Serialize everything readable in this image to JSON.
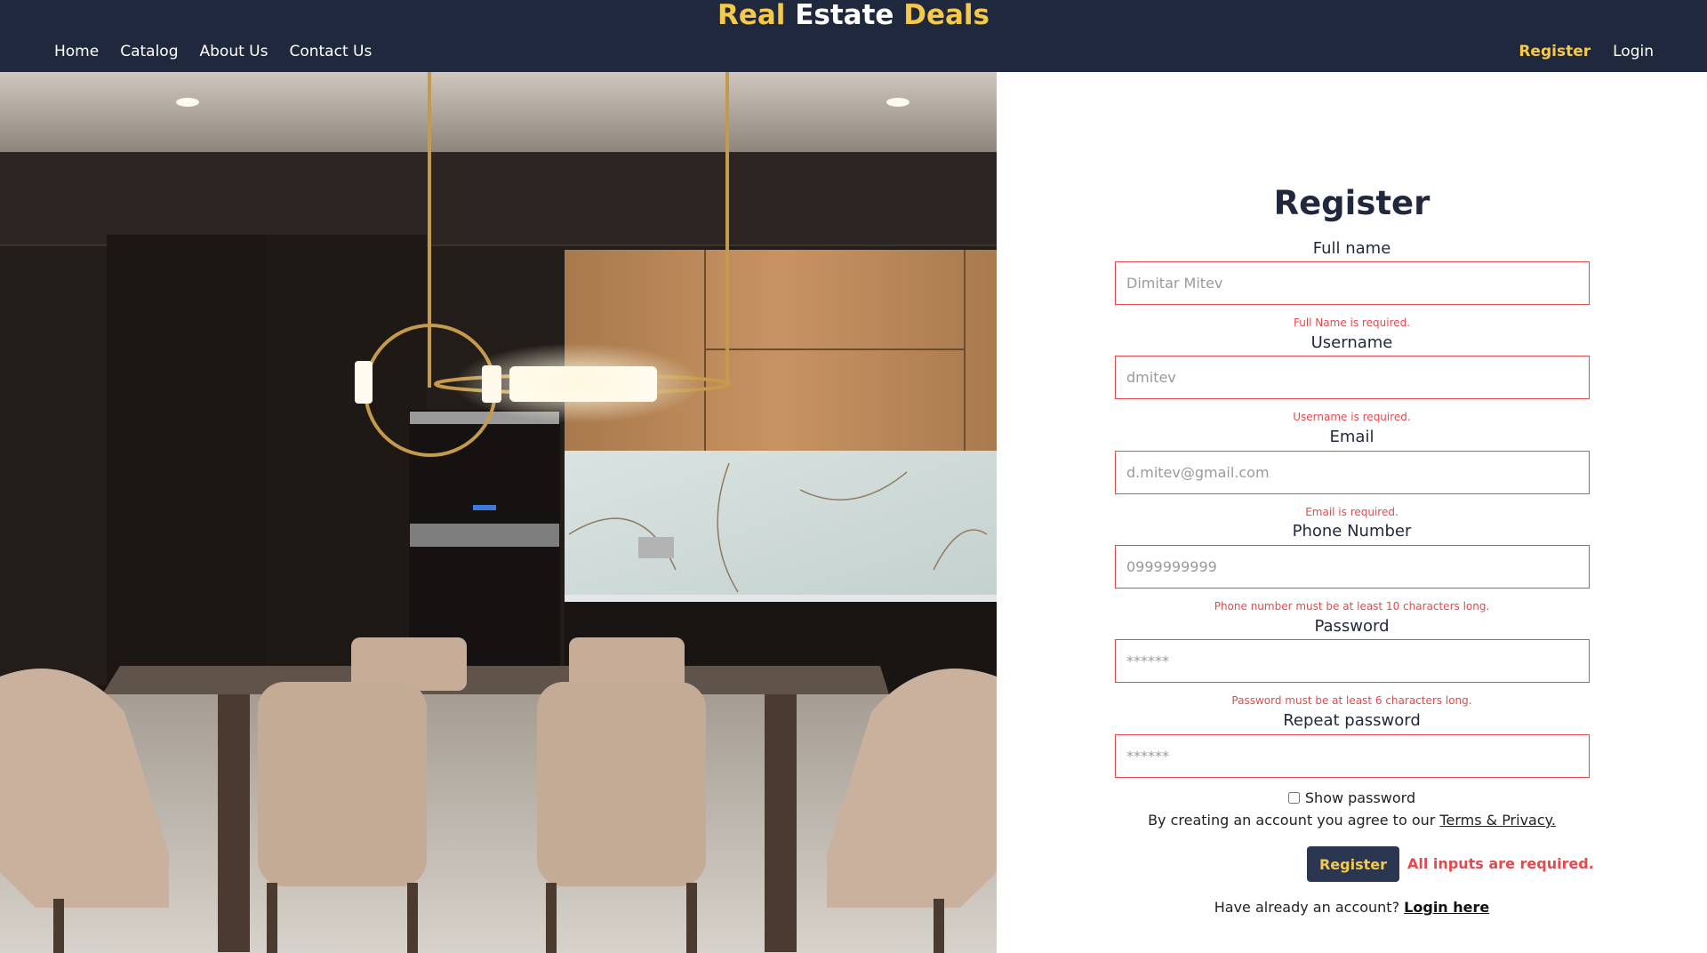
{
  "header": {
    "brand_part1": "Real",
    "brand_part2": "Estate",
    "brand_part3": "Deals",
    "nav": [
      "Home",
      "Catalog",
      "About Us",
      "Contact Us"
    ],
    "register": "Register",
    "login": "Login"
  },
  "form": {
    "title": "Register",
    "fields": [
      {
        "label": "Full name",
        "placeholder": "Dimitar Mitev",
        "error": "Full Name is required."
      },
      {
        "label": "Username",
        "placeholder": "dmitev",
        "error": "Username is required."
      },
      {
        "label": "Email",
        "placeholder": "d.mitev@gmail.com",
        "error": "Email is required."
      },
      {
        "label": "Phone Number",
        "placeholder": "0999999999",
        "error": "Phone number must be at least 10 characters long."
      },
      {
        "label": "Password",
        "placeholder": "******",
        "error": "Password must be at least 6 characters long."
      },
      {
        "label": "Repeat password",
        "placeholder": "******",
        "error": ""
      }
    ],
    "show_password": "Show password",
    "terms_prefix": "By creating an account you agree to our",
    "terms_link": "Terms & Privacy.",
    "submit": "Register",
    "form_error": "All inputs are required.",
    "login_prompt": "Have already an account?",
    "login_link": "Login here"
  },
  "colors": {
    "header_bg": "#1f283c",
    "accent_yellow": "#f5c94a",
    "error_red": "#e5484d"
  }
}
